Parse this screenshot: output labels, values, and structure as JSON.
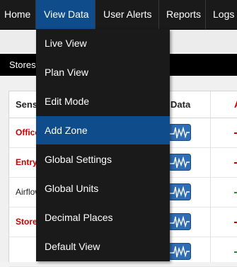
{
  "nav": {
    "items": [
      {
        "label": "Home"
      },
      {
        "label": "View Data"
      },
      {
        "label": "User Alerts"
      },
      {
        "label": "Reports"
      },
      {
        "label": "Logs"
      }
    ],
    "active_index": 1
  },
  "subnav": {
    "stores_label": "Stores"
  },
  "table": {
    "headers": {
      "sensor": "Sensor",
      "data": "Data",
      "extra": "A"
    },
    "rows": [
      {
        "name": "Office",
        "status": "alert"
      },
      {
        "name": "Entry",
        "status": "alert"
      },
      {
        "name": "Airflow",
        "status": "ok"
      },
      {
        "name": "Store",
        "status": "alert"
      },
      {
        "name": "",
        "status": "ok"
      }
    ]
  },
  "dropdown": {
    "items": [
      {
        "label": "Live View"
      },
      {
        "label": "Plan View"
      },
      {
        "label": "Edit Mode"
      },
      {
        "label": "Add Zone"
      },
      {
        "label": "Global Settings"
      },
      {
        "label": "Global Units"
      },
      {
        "label": "Decimal Places"
      },
      {
        "label": "Default View"
      }
    ],
    "highlighted_index": 3
  },
  "colors": {
    "accent": "#0f4c8c",
    "alert_text": "#cc0000",
    "nav_bg": "#1a1a1a"
  },
  "icons": {
    "graph": "graph-chart-icon"
  }
}
